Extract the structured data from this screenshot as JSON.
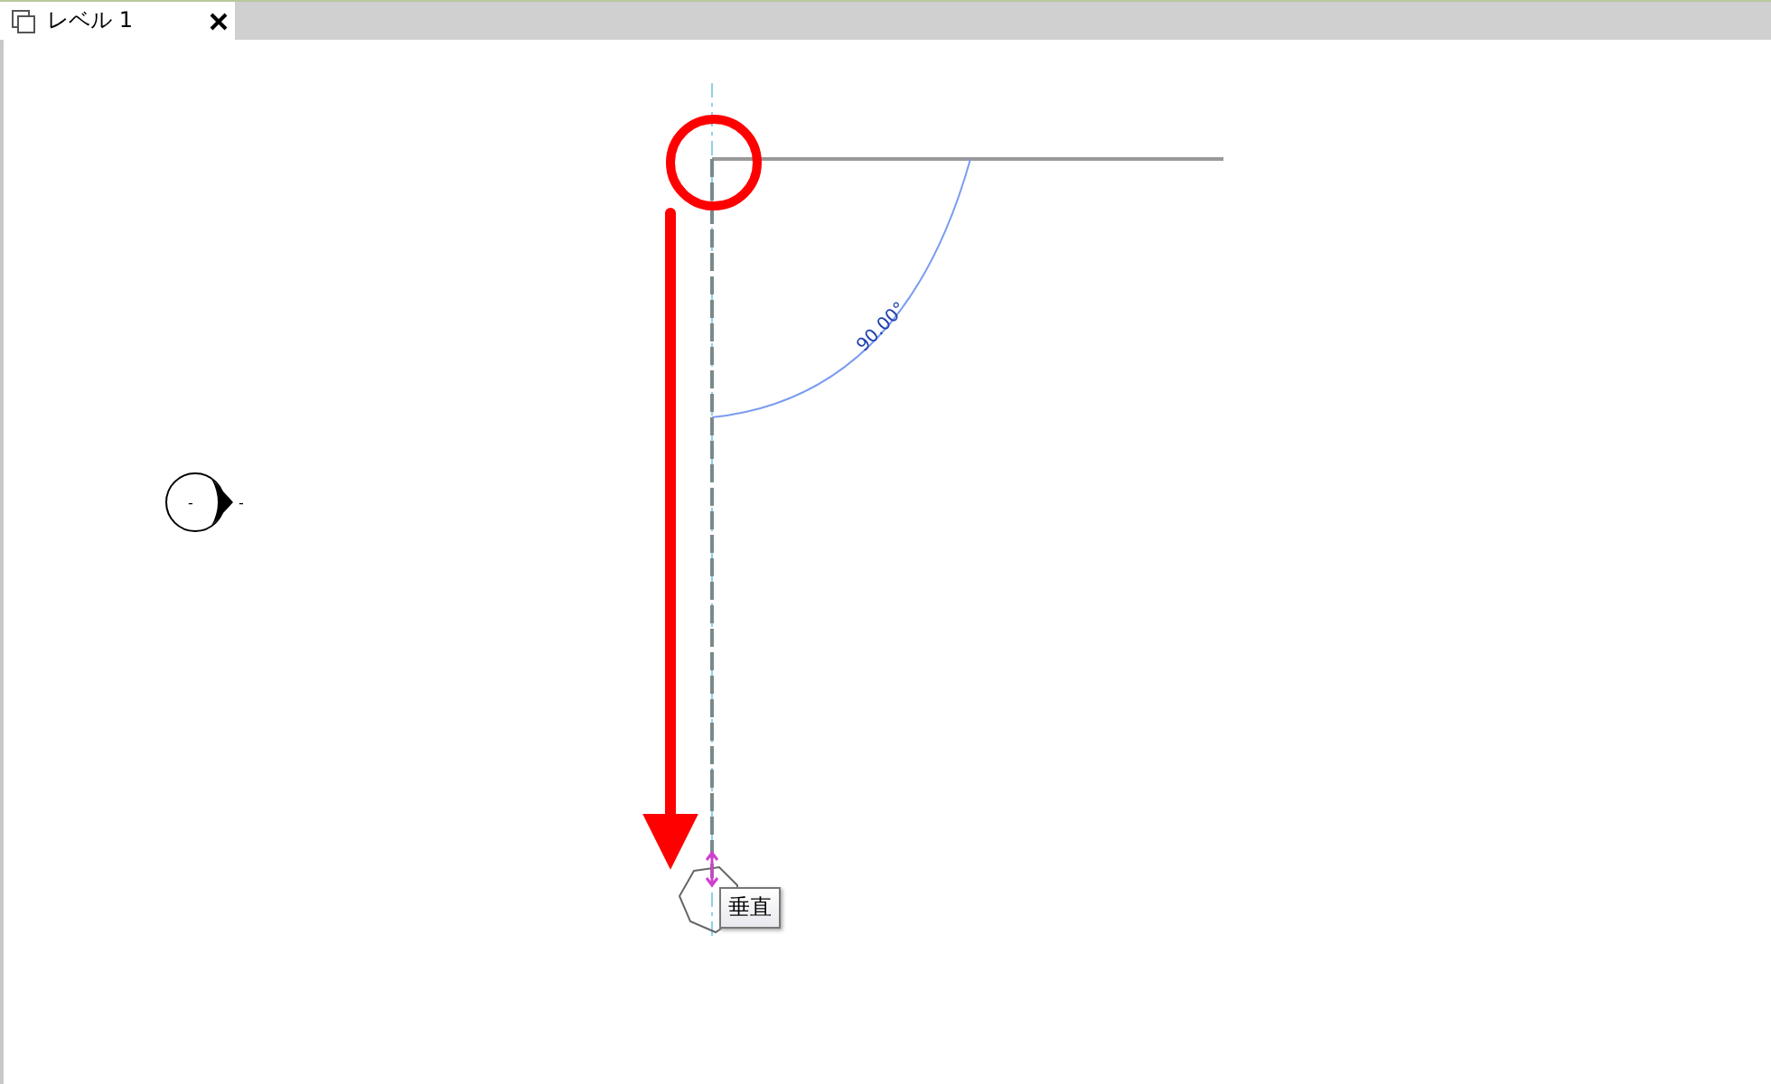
{
  "tabs": [
    {
      "label": "レベル 1",
      "selected": true
    }
  ],
  "canvas": {
    "elevation_marker": {
      "label": "-",
      "tail": "-"
    },
    "angle_dimension": {
      "text": "90.00°"
    },
    "snap_tooltip": {
      "text": "垂直"
    }
  }
}
